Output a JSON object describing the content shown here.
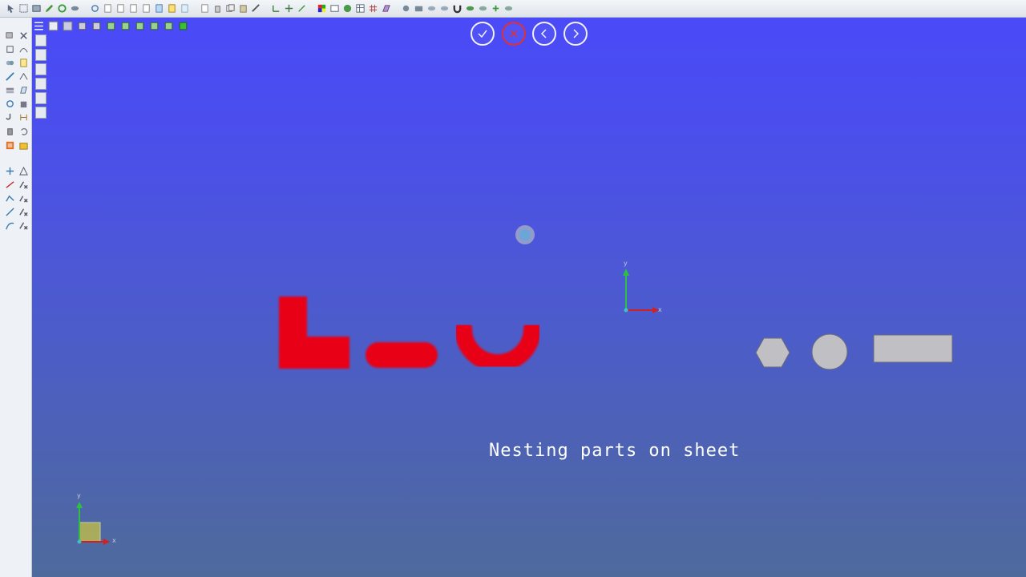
{
  "caption": {
    "text": "Nesting parts on sheet"
  },
  "axes": {
    "x_label": "x",
    "y_label": "y"
  },
  "colors": {
    "viewport_top": "#4a4af8",
    "viewport_bottom": "#4e6a9c",
    "part_red": "#e80018",
    "shape_gray": "#c0c0c4",
    "cancel_red": "#e23030"
  },
  "dialog_nav": {
    "confirm": "check-icon",
    "cancel": "close-icon",
    "previous": "chevron-left-icon",
    "next": "chevron-right-icon"
  },
  "parts_to_nest": [
    "l-bracket-part",
    "slot-part",
    "u-hook-part"
  ],
  "sheet_shapes": [
    "hexagon-shape",
    "circle-shape",
    "rectangle-shape"
  ]
}
